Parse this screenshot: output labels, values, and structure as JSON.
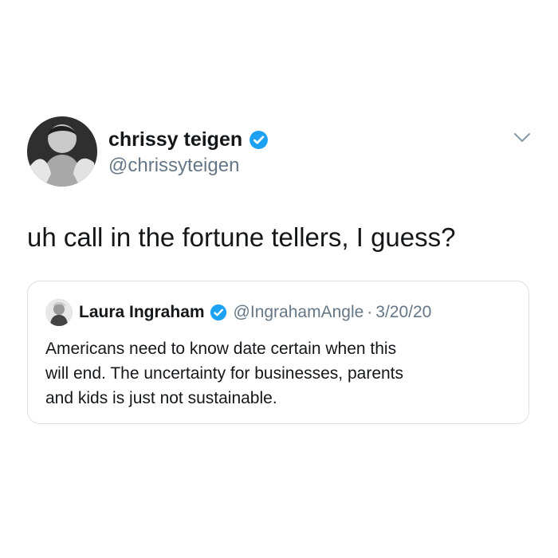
{
  "tweet": {
    "author": {
      "name": "chrissy teigen",
      "handle": "@chrissyteigen"
    },
    "text": "uh call in the fortune tellers, I guess?",
    "menu_icon": "chevron-down-icon",
    "quote": {
      "author": {
        "name": "Laura Ingraham",
        "handle": "@IngrahamAngle"
      },
      "separator": "·",
      "date": "3/20/20",
      "text_lines": [
        "Americans need to know date certain when this",
        "will end.  The uncertainty for businesses, parents",
        "and kids is just not sustainable."
      ]
    }
  },
  "colors": {
    "verified": "#1DA1F2",
    "secondary_text": "#657786",
    "primary_text": "#14171A",
    "border": "#D8E0E6"
  }
}
